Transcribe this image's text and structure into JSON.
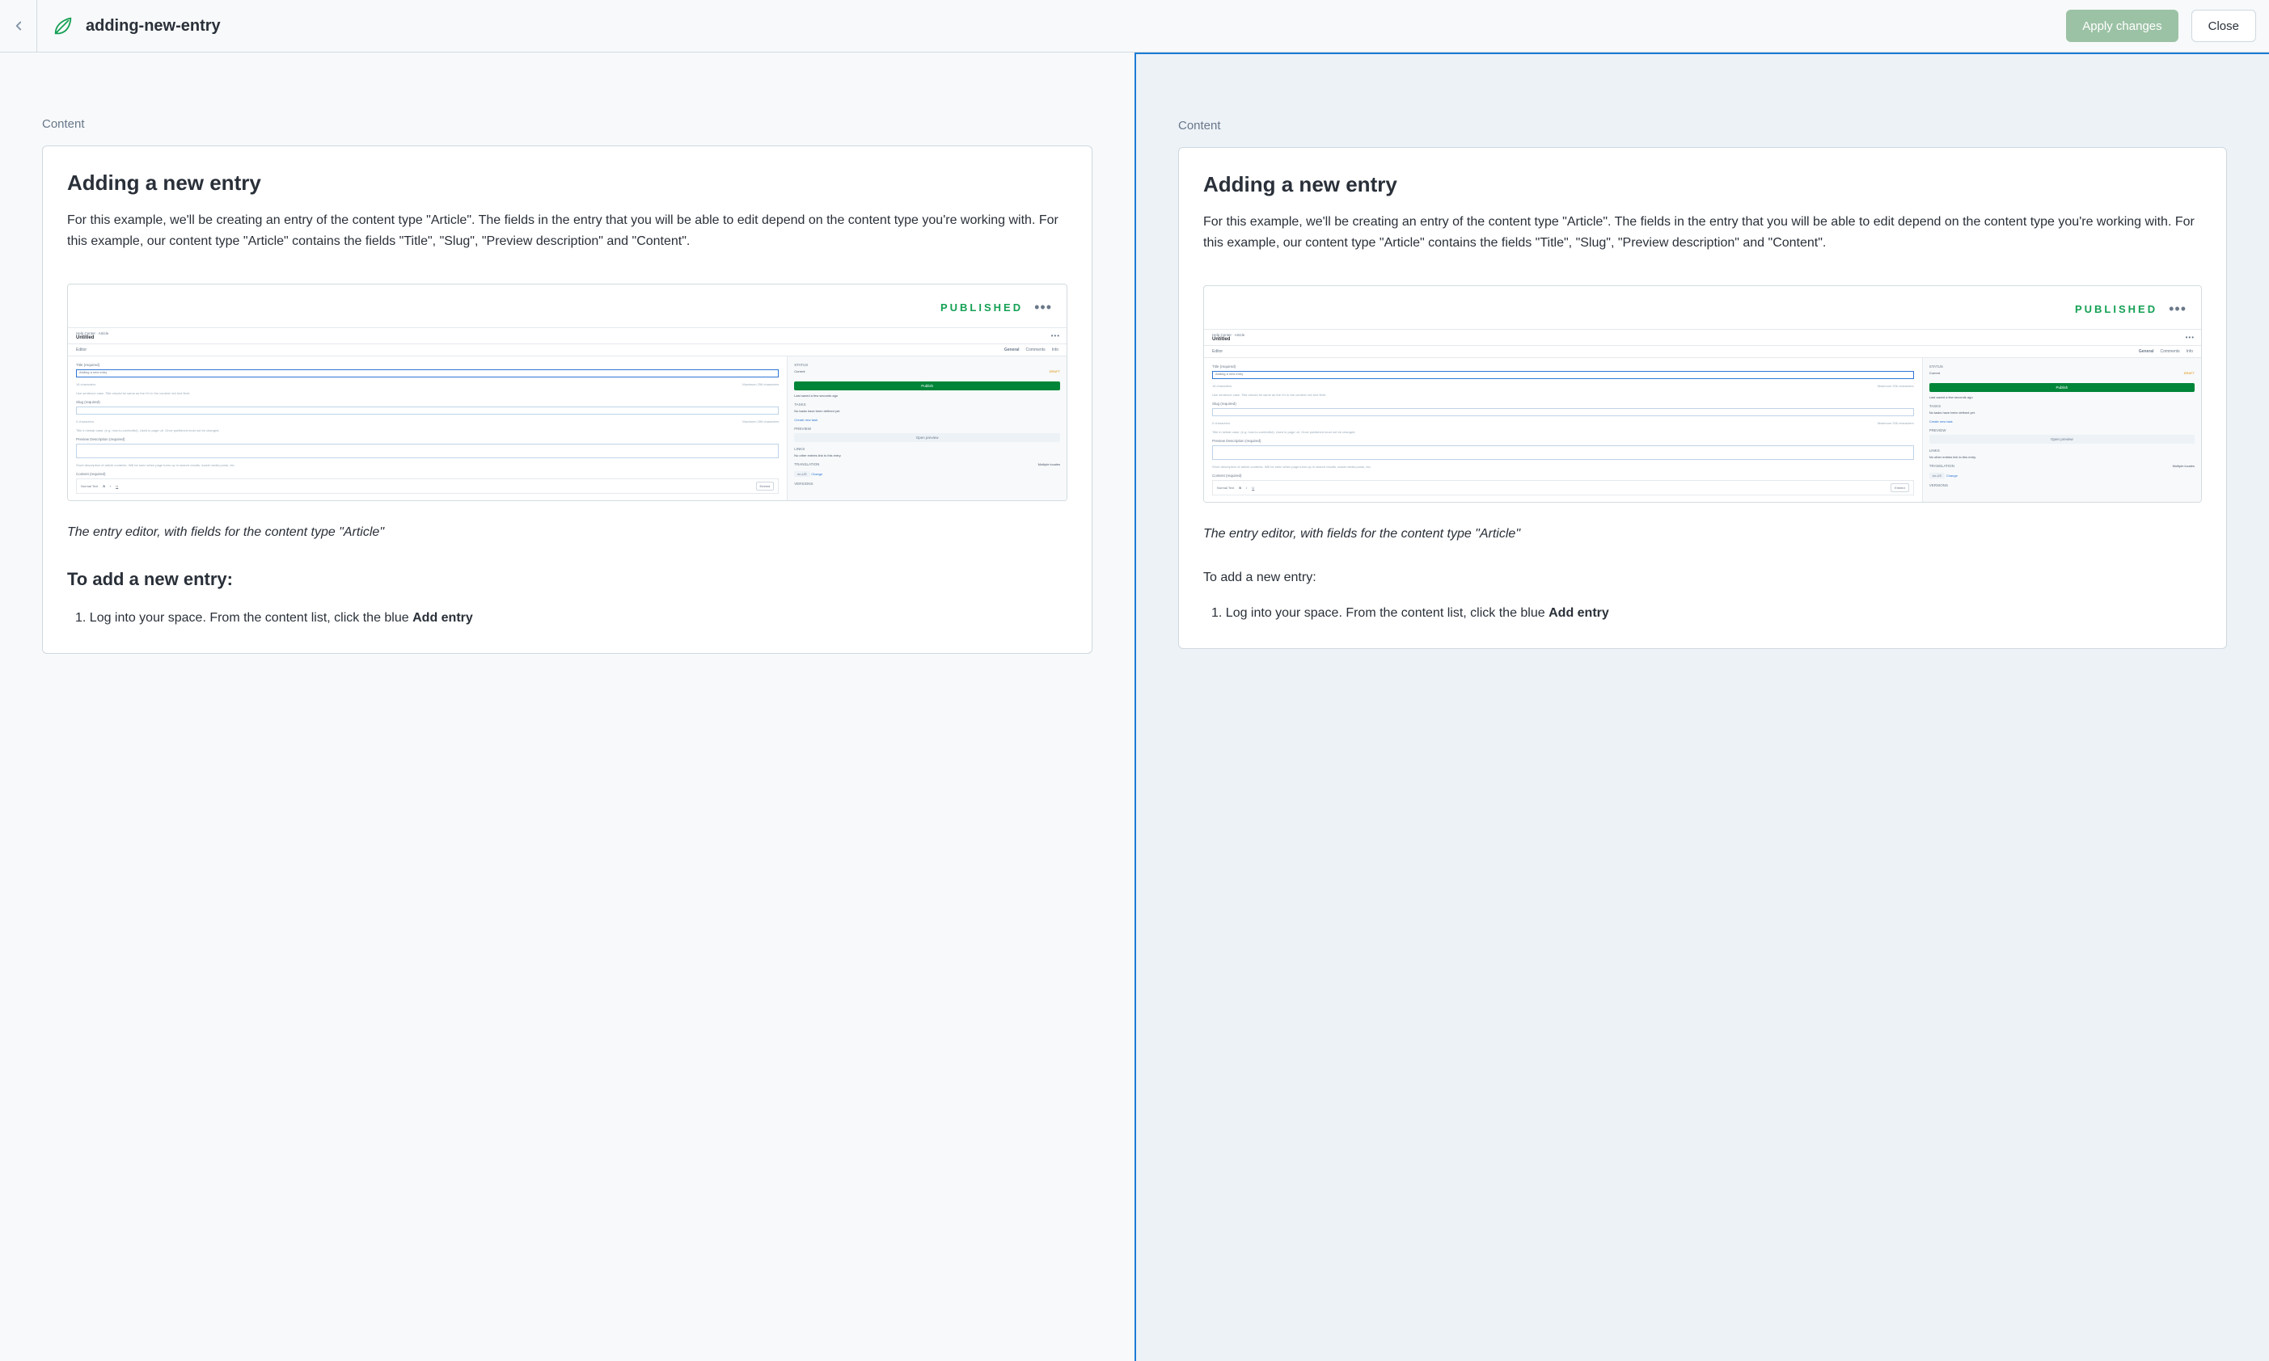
{
  "header": {
    "title": "adding-new-entry",
    "apply_label": "Apply changes",
    "close_label": "Close"
  },
  "section_label": "Content",
  "article": {
    "heading": "Adding a new entry",
    "body": "For this example, we'll be creating an entry of the content type \"Article\". The fields in the entry that you will be able to edit depend on the content type you're working with. For this example, our content type \"Article\" contains the fields \"Title\", \"Slug\", \"Preview description\" and \"Content\".",
    "caption": "The entry editor, with fields for the content type \"Article\"",
    "sub_heading": "To add a new entry:",
    "step1_prefix": "1. Log into your space. From the content list, click the blue ",
    "step1_bold": "Add entry"
  },
  "embedded": {
    "published": "PUBLISHED",
    "breadcrumb": "Help Center · Article",
    "entry_title": "Untitled",
    "tabs": {
      "general": "General",
      "comments": "Comments",
      "info": "Info"
    },
    "editor_label": "Editor",
    "field_title": "Title (required)",
    "field_title_value": "Adding a new entry",
    "field_title_count": "18 characters",
    "field_title_max": "Maximum 256 characters",
    "field_title_hint": "Use sentence case. Title should be same as the H1 in the content rich text field.",
    "field_slug": "Slug (required)",
    "field_slug_count": "0 characters",
    "field_slug_max": "Maximum 256 characters",
    "field_slug_hint": "Title in kebab case. (e.g. how-to-contentful). Used in page url. Once published must not be changed.",
    "field_preview": "Preview Description (required)",
    "field_preview_hint": "Short description of article contents. Will be seen when page turns up in search results, social media posts, etc.",
    "field_content": "Content (required)",
    "toolbar_normal": "Normal Text",
    "embed_btn": "Embed",
    "side_status": "STATUS",
    "side_current": "Current",
    "side_draft": "DRAFT",
    "side_publish": "Publish",
    "side_last_saved": "Last saved a few seconds ago",
    "side_tasks": "TASKS",
    "side_tasks_text": "No tasks have been defined yet.",
    "side_create_task": "Create new task",
    "side_preview": "PREVIEW",
    "side_open_preview": "Open preview",
    "side_links": "LINKS",
    "side_links_text": "No other entries link to this entry.",
    "side_translation": "TRANSLATION",
    "side_translation_val": "Multiple locales",
    "side_lang": "en-US",
    "side_change": "Change",
    "side_versions": "VERSIONS"
  }
}
